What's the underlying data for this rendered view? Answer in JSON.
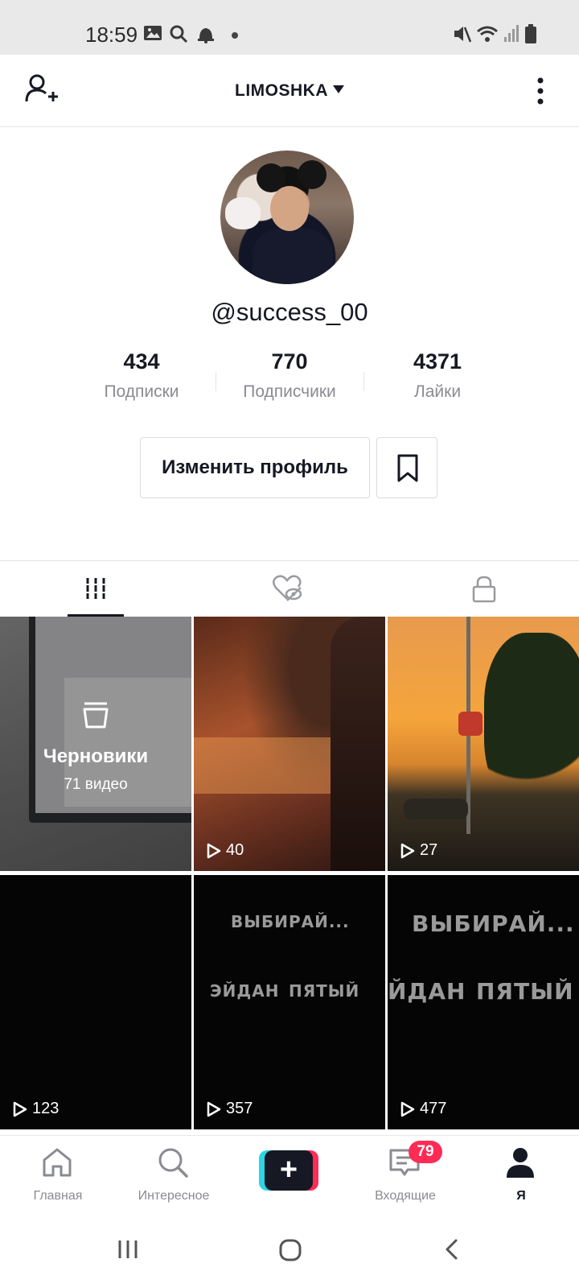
{
  "status_bar": {
    "time": "18:59",
    "icons": [
      "image-icon",
      "search-icon",
      "alarm-icon",
      "dot-icon",
      "mute-icon",
      "wifi-icon",
      "signal-icon",
      "battery-icon"
    ]
  },
  "header": {
    "title": "LIMOSHKA",
    "icons": [
      "add-user-icon",
      "caret-down-icon",
      "more-vertical-icon"
    ]
  },
  "profile": {
    "username": "@success_00",
    "stats": [
      {
        "value": "434",
        "label": "Подписки"
      },
      {
        "value": "770",
        "label": "Подписчики"
      },
      {
        "value": "4371",
        "label": "Лайки"
      }
    ],
    "edit_label": "Изменить профиль",
    "bookmark_icon": "bookmark-icon"
  },
  "tabs": [
    {
      "icon": "grid-icon",
      "active": true
    },
    {
      "icon": "liked-hidden-icon",
      "active": false
    },
    {
      "icon": "lock-icon",
      "active": false
    }
  ],
  "grid": {
    "drafts": {
      "title": "Черновики",
      "subtitle": "71 видео",
      "icon": "trash-icon"
    },
    "videos": [
      {
        "views": "40"
      },
      {
        "views": "27"
      },
      {
        "views": "123"
      },
      {
        "views": "357",
        "text_top": "ВЫБИРАЙ...",
        "text_left": "ЭЙДАН",
        "text_right": "ПЯТЫЙ"
      },
      {
        "views": "477",
        "text_top": "ВЫБИРАЙ...",
        "text_left": "ЙДАН",
        "text_right": "ПЯТЫЙ"
      }
    ]
  },
  "bottom_nav": {
    "items": [
      {
        "label": "Главная",
        "icon": "home-icon"
      },
      {
        "label": "Интересное",
        "icon": "search-icon"
      },
      {
        "label": "",
        "icon": "plus-icon"
      },
      {
        "label": "Входящие",
        "icon": "inbox-icon",
        "badge": "79"
      },
      {
        "label": "Я",
        "icon": "profile-icon",
        "active": true
      }
    ]
  },
  "system_nav": {
    "icons": [
      "recents-icon",
      "home-circle-icon",
      "back-icon"
    ]
  },
  "colors": {
    "accent": "#fe2c55",
    "cyan": "#2dd4e5",
    "text": "#161823",
    "muted": "#8a8b91"
  }
}
